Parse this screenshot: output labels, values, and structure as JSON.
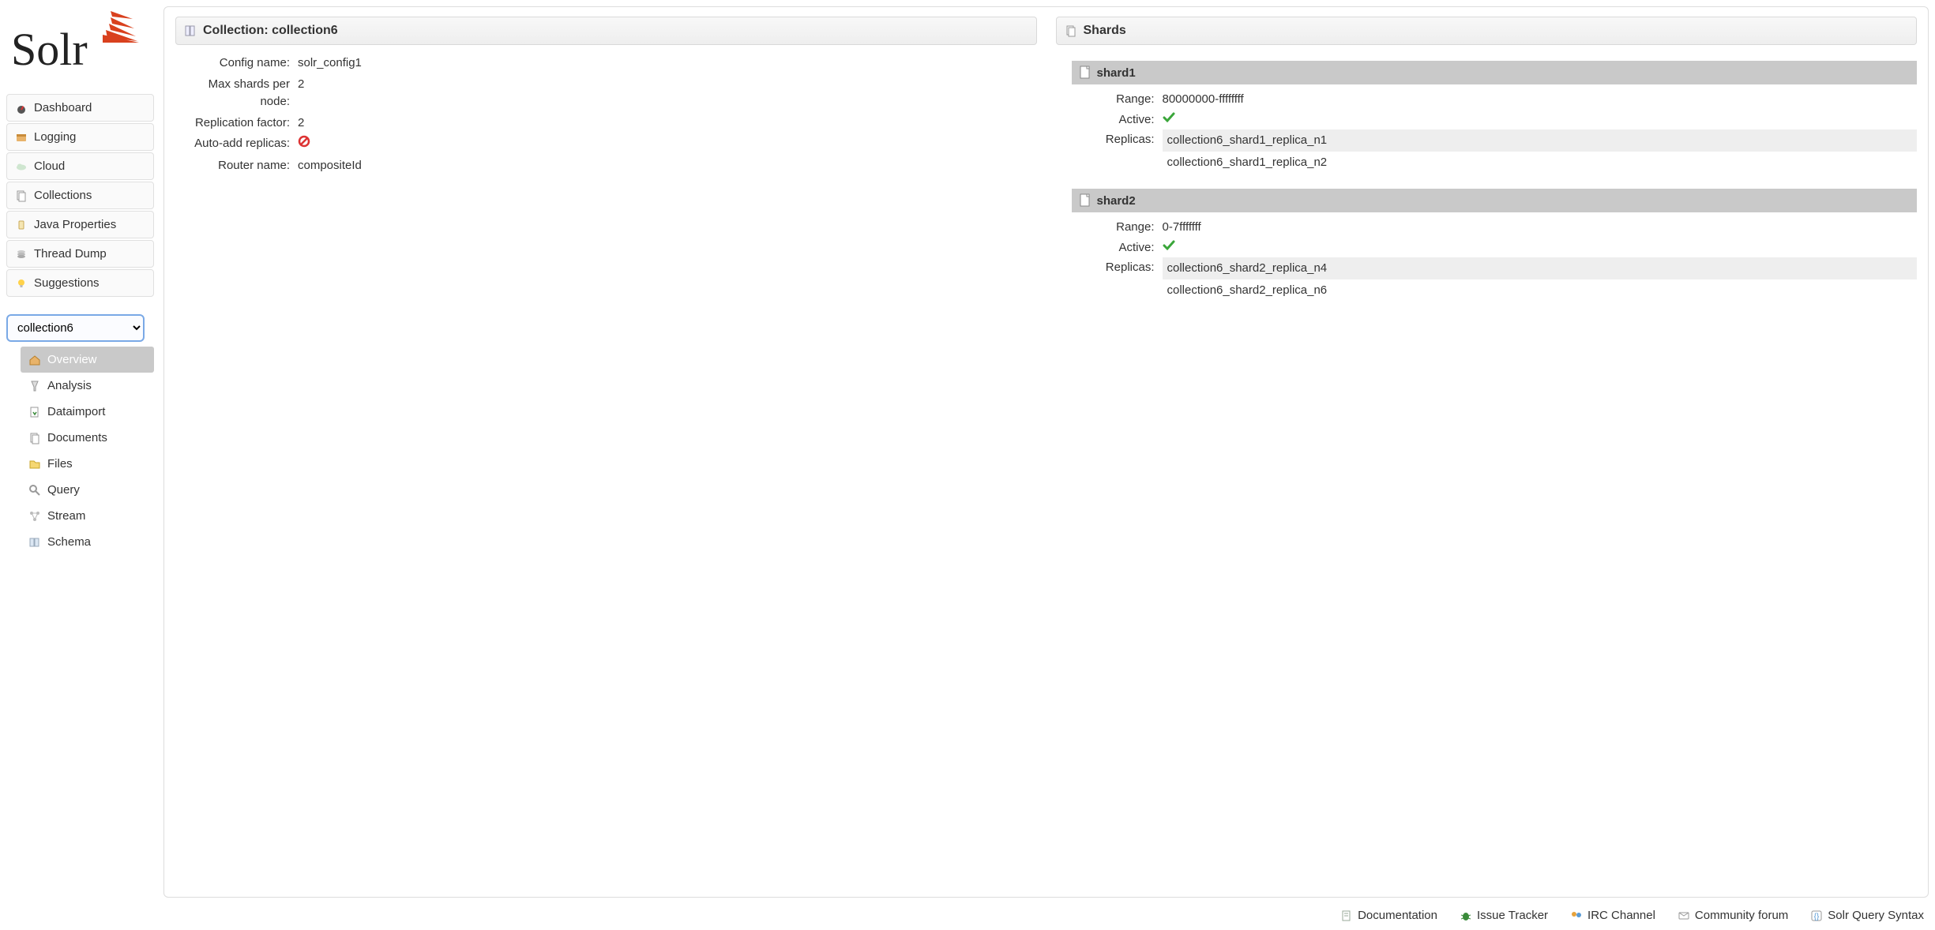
{
  "sidebar": {
    "nav": [
      {
        "label": "Dashboard",
        "icon": "dashboard-icon"
      },
      {
        "label": "Logging",
        "icon": "logging-icon"
      },
      {
        "label": "Cloud",
        "icon": "cloud-icon"
      },
      {
        "label": "Collections",
        "icon": "collections-icon"
      },
      {
        "label": "Java Properties",
        "icon": "java-properties-icon"
      },
      {
        "label": "Thread Dump",
        "icon": "thread-dump-icon"
      },
      {
        "label": "Suggestions",
        "icon": "suggestions-icon"
      }
    ],
    "core_select": {
      "selected": "collection6"
    },
    "subnav": [
      {
        "label": "Overview",
        "icon": "overview-icon",
        "active": true
      },
      {
        "label": "Analysis",
        "icon": "analysis-icon"
      },
      {
        "label": "Dataimport",
        "icon": "dataimport-icon"
      },
      {
        "label": "Documents",
        "icon": "documents-icon"
      },
      {
        "label": "Files",
        "icon": "files-icon"
      },
      {
        "label": "Query",
        "icon": "query-icon"
      },
      {
        "label": "Stream",
        "icon": "stream-icon"
      },
      {
        "label": "Schema",
        "icon": "schema-icon"
      }
    ]
  },
  "collection_panel": {
    "title": "Collection: collection6",
    "rows": {
      "config_name": {
        "label": "Config name:",
        "value": "solr_config1"
      },
      "max_shards": {
        "label": "Max shards per node:",
        "value": "2"
      },
      "rep_factor": {
        "label": "Replication factor:",
        "value": "2"
      },
      "auto_add": {
        "label": "Auto-add replicas:",
        "value_icon": "forbidden"
      },
      "router": {
        "label": "Router name:",
        "value": "compositeId"
      }
    }
  },
  "shards_panel": {
    "title": "Shards"
  },
  "shards": [
    {
      "name": "shard1",
      "range": "80000000-ffffffff",
      "active": true,
      "replicas": [
        {
          "name": "collection6_shard1_replica_n1",
          "leader": true
        },
        {
          "name": "collection6_shard1_replica_n2",
          "leader": false
        }
      ]
    },
    {
      "name": "shard2",
      "range": "0-7fffffff",
      "active": true,
      "replicas": [
        {
          "name": "collection6_shard2_replica_n4",
          "leader": true
        },
        {
          "name": "collection6_shard2_replica_n6",
          "leader": false
        }
      ]
    }
  ],
  "shard_labels": {
    "range": "Range:",
    "active": "Active:",
    "replicas": "Replicas:"
  },
  "footer": [
    {
      "label": "Documentation",
      "icon": "doc-icon"
    },
    {
      "label": "Issue Tracker",
      "icon": "bug-icon"
    },
    {
      "label": "IRC Channel",
      "icon": "irc-icon"
    },
    {
      "label": "Community forum",
      "icon": "forum-icon"
    },
    {
      "label": "Solr Query Syntax",
      "icon": "syntax-icon"
    }
  ]
}
